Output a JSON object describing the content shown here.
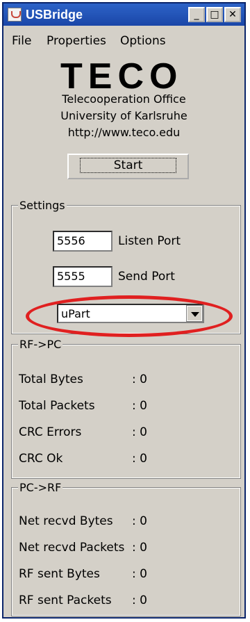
{
  "window": {
    "title": "USBridge",
    "minimize": "_",
    "maximize": "□",
    "close": "✕"
  },
  "menu": [
    "File",
    "Properties",
    "Options"
  ],
  "logo": {
    "text": "TECO",
    "lines": [
      "Telecooperation Office",
      "University of Karlsruhe",
      "http://www.teco.edu"
    ]
  },
  "start_label": "Start",
  "settings": {
    "title": "Settings",
    "listen_port": "5556",
    "listen_label": "Listen Port",
    "send_port": "5555",
    "send_label": "Send Port",
    "device": "uPart"
  },
  "rf_to_pc": {
    "title": "RF->PC",
    "rows": [
      {
        "label": "Total Bytes",
        "value": ": 0"
      },
      {
        "label": "Total Packets",
        "value": ": 0"
      },
      {
        "label": "CRC Errors",
        "value": ": 0"
      },
      {
        "label": "CRC Ok",
        "value": ": 0"
      }
    ]
  },
  "pc_to_rf": {
    "title": "PC->RF",
    "rows": [
      {
        "label": "Net recvd Bytes",
        "value": ": 0"
      },
      {
        "label": "Net recvd Packets",
        "value": ": 0"
      },
      {
        "label": "RF sent  Bytes",
        "value": ": 0"
      },
      {
        "label": "RF sent Packets",
        "value": ": 0"
      }
    ]
  },
  "colors": {
    "highlight_ellipse": "#e02020",
    "titlebar": "#2d63c8",
    "window_bg": "#d4d0c8"
  }
}
